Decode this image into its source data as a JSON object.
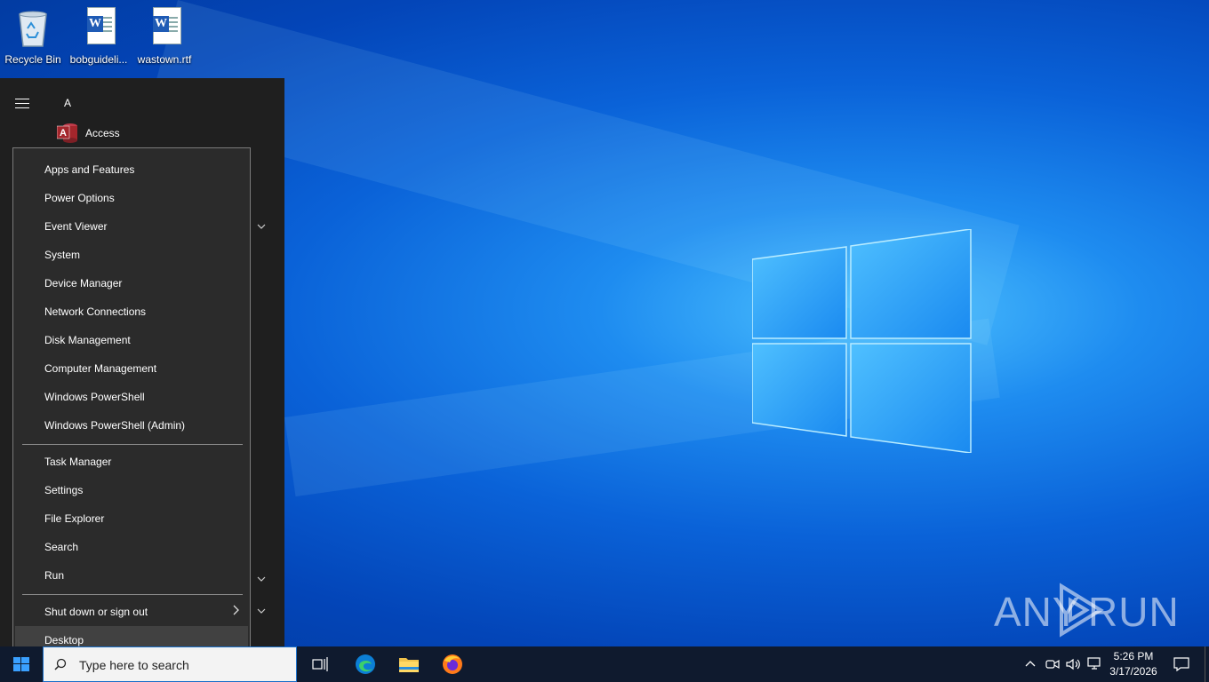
{
  "desktop": {
    "icons": [
      {
        "label": "Recycle Bin",
        "icon": "recycle-bin-icon"
      },
      {
        "label": "bobguideli...",
        "icon": "word-document-icon"
      },
      {
        "label": "wastown.rtf",
        "icon": "word-document-icon"
      }
    ],
    "watermark": {
      "left": "ANY",
      "right": "RUN"
    }
  },
  "start_menu": {
    "section_letter": "A",
    "apps": [
      {
        "label": "Access",
        "icon": "access-icon"
      }
    ]
  },
  "context_menu": {
    "group1": [
      "Apps and Features",
      "Power Options",
      "Event Viewer",
      "System",
      "Device Manager",
      "Network Connections",
      "Disk Management",
      "Computer Management",
      "Windows PowerShell",
      "Windows PowerShell (Admin)"
    ],
    "group2": [
      "Task Manager",
      "Settings",
      "File Explorer",
      "Search",
      "Run"
    ],
    "group3": [
      "Shut down or sign out",
      "Desktop"
    ],
    "highlighted": "Desktop"
  },
  "taskbar": {
    "search_placeholder": "Type here to search",
    "pinned": [
      "task-view-icon",
      "edge-icon",
      "file-explorer-icon",
      "firefox-icon"
    ],
    "time": "5:26 PM",
    "date": "3/17/2026"
  },
  "colors": {
    "menu_bg": "#2b2b2b",
    "start_bg": "#1f1f1f",
    "taskbar_bg": "#0f1a2e",
    "accent": "#0a62d8"
  }
}
